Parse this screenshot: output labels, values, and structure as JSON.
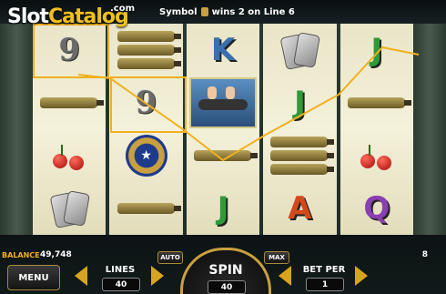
{
  "watermark": {
    "slot": "Slot",
    "catalog": "Catalog",
    "com": ".com"
  },
  "message": {
    "symbol_word": "Symbol",
    "rest": "wins 2 on Line 6"
  },
  "reels": [
    [
      "9",
      "bomb",
      "cherry",
      "dog-tags"
    ],
    [
      "bombs",
      "9",
      "emblem",
      "bomb"
    ],
    [
      "K",
      "pinup-photo",
      "bomb",
      "J"
    ],
    [
      "dog-tags",
      "J",
      "bombs",
      "A"
    ],
    [
      "J",
      "bomb",
      "cherry",
      "Q"
    ]
  ],
  "colors": {
    "accent": "#f0b020",
    "reel_bg": "#f4f1da",
    "win_line": "#f0b020"
  },
  "balance": {
    "label": "BALANCE",
    "value": "49,748"
  },
  "right_value": "8",
  "buttons": {
    "menu": "MENU",
    "auto": "AUTO",
    "max": "MAX"
  },
  "lines": {
    "label": "LINES",
    "value": "40"
  },
  "spin": {
    "label": "SPIN",
    "value": "40"
  },
  "bet_per": {
    "label": "BET PER",
    "value": "1"
  }
}
